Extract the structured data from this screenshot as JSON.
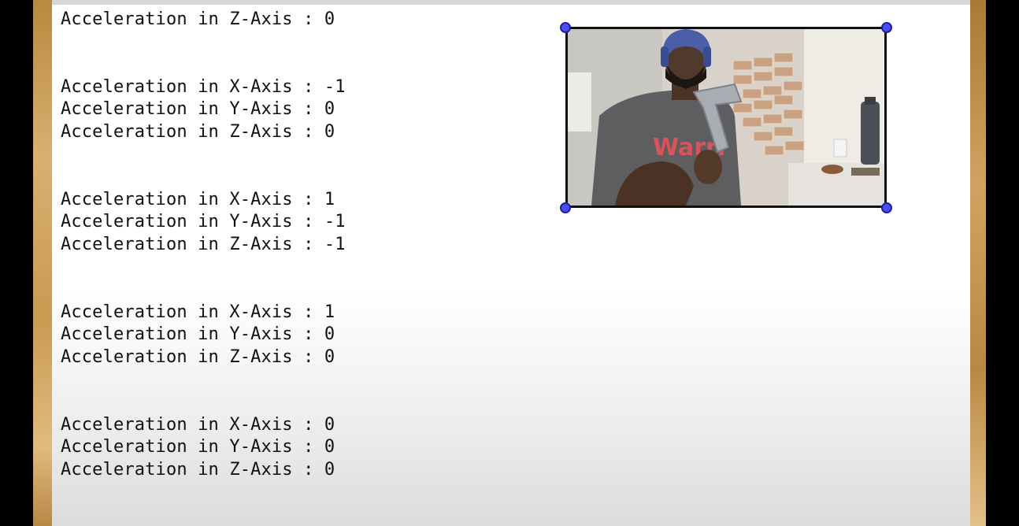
{
  "terminal": {
    "lines": [
      "Acceleration in Z-Axis : 0",
      "",
      "",
      "Acceleration in X-Axis : -1",
      "Acceleration in Y-Axis : 0",
      "Acceleration in Z-Axis : 0",
      "",
      "",
      "Acceleration in X-Axis : 1",
      "Acceleration in Y-Axis : -1",
      "Acceleration in Z-Axis : -1",
      "",
      "",
      "Acceleration in X-Axis : 1",
      "Acceleration in Y-Axis : 0",
      "Acceleration in Z-Axis : 0",
      "",
      "",
      "Acceleration in X-Axis : 0",
      "Acceleration in Y-Axis : 0",
      "Acceleration in Z-Axis : 0"
    ]
  },
  "pip_video": {
    "shirt_text": "Warri",
    "handle_color": "#4a4ef0"
  }
}
